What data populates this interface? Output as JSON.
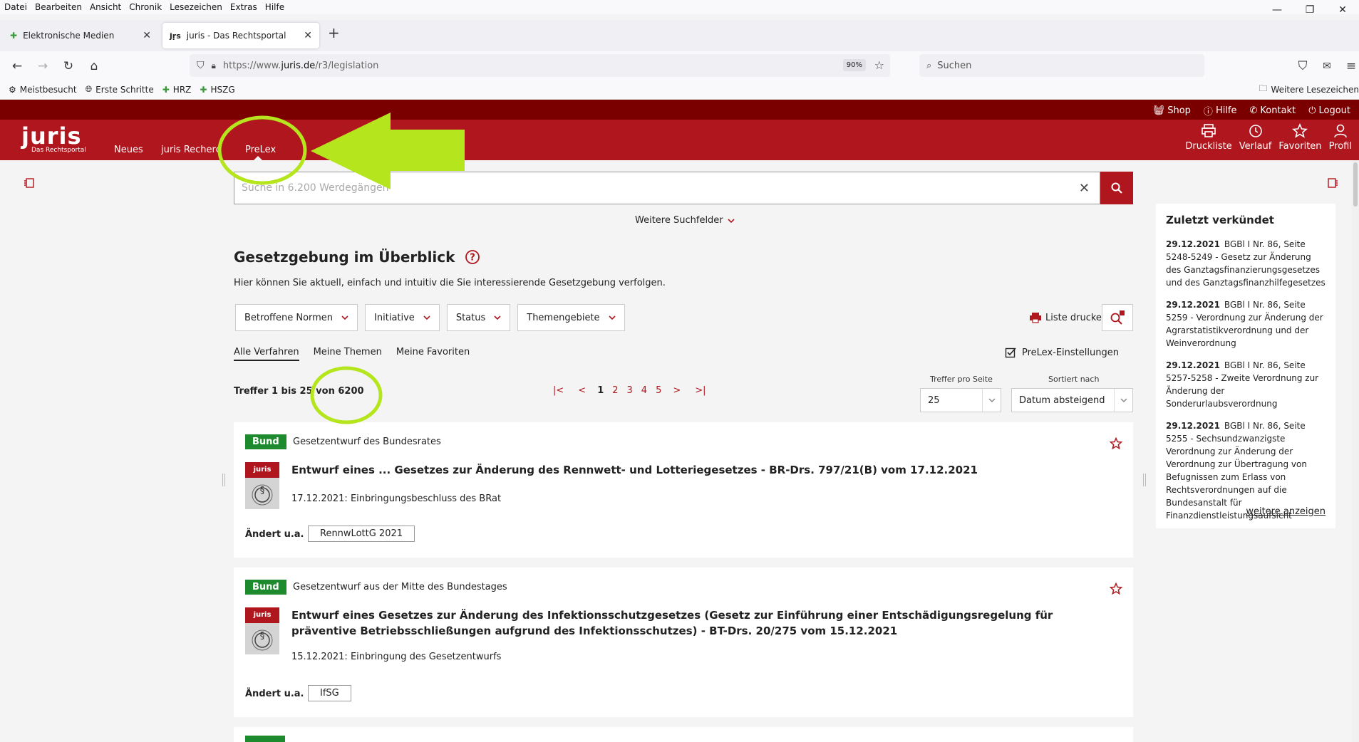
{
  "menubar": [
    "Datei",
    "Bearbeiten",
    "Ansicht",
    "Chronik",
    "Lesezeichen",
    "Extras",
    "Hilfe"
  ],
  "tabs": [
    {
      "title": "Elektronische Medien"
    },
    {
      "title": "juris - Das Rechtsportal"
    }
  ],
  "url": {
    "prefix": "https://www.",
    "domain": "juris.de",
    "path": "/r3/legislation",
    "zoom": "90%"
  },
  "browser_search": {
    "placeholder": "Suchen"
  },
  "bookmarks": [
    "Meistbesucht",
    "Erste Schritte",
    "HRZ",
    "HSZG"
  ],
  "bookmarks_more": "Weitere Lesezeichen",
  "top_links": [
    "Shop",
    "Hilfe",
    "Kontakt",
    "Logout"
  ],
  "logo": {
    "name": "juris",
    "sub": "Das Rechtsportal"
  },
  "main_nav": [
    "Neues",
    "juris Recherche",
    "PreLex"
  ],
  "right_nav": [
    "Druckliste",
    "Verlauf",
    "Favoriten",
    "Profil"
  ],
  "search": {
    "placeholder": "Suche in 6.200 Werdegängen"
  },
  "weitere_suchfelder": "Weitere Suchfelder",
  "heading": "Gesetzgebung im Überblick",
  "intro": "Hier können Sie aktuell, einfach und intuitiv die Sie interessierende Gesetzgebung verfolgen.",
  "filters": [
    "Betroffene Normen",
    "Initiative",
    "Status",
    "Themengebiete"
  ],
  "print_list": "Liste drucken",
  "subtabs": [
    "Alle Verfahren",
    "Meine Themen",
    "Meine Favoriten"
  ],
  "settings": "PreLex-Einstellungen",
  "treffer": "Treffer 1 bis 25 von 6200",
  "pagination": [
    "1",
    "2",
    "3",
    "4",
    "5"
  ],
  "per_page": {
    "label": "Treffer pro Seite",
    "value": "25"
  },
  "sort": {
    "label": "Sortiert nach",
    "value": "Datum absteigend"
  },
  "cards": [
    {
      "badge": "Bund",
      "type": "Gesetzentwurf des Bundesrates",
      "title": "Entwurf eines ... Gesetzes zur Änderung des Rennwett- und Lotteriegesetzes - BR-Drs. 797/21(B) vom 17.12.2021",
      "date": "17.12.2021: Einbringungsbeschluss des BRat",
      "aendert_label": "Ändert u.a.",
      "norm": "RennwLottG 2021"
    },
    {
      "badge": "Bund",
      "type": "Gesetzentwurf aus der Mitte des Bundestages",
      "title": "Entwurf eines Gesetzes zur Änderung des Infektionsschutzgesetzes (Gesetz zur Einführung einer Entschädigungsregelung für präventive Betriebsschließun­gen aufgrund des Infektionsschutzes) - BT-Drs. 20/275 vom 15.12.2021",
      "date": "15.12.2021: Einbringung des Gesetzentwurfs",
      "aendert_label": "Ändert u.a.",
      "norm": "IfSG"
    }
  ],
  "sidebar": {
    "title": "Zuletzt verkündet",
    "items": [
      {
        "date": "29.12.2021",
        "text": "BGBl I Nr. 86, Seite 5248-5249 - Gesetz zur Änderung des Ganztagsfinanzierungsgesetzes und des Ganztagsfinanzhilfegesetzes"
      },
      {
        "date": "29.12.2021",
        "text": "BGBl I Nr. 86, Seite 5259 - Verordnung zur Änderung der Agrarsta­tistikverordnung und der Weinverord­nung"
      },
      {
        "date": "29.12.2021",
        "text": "BGBl I Nr. 86, Seite 5257-5258 - Zweite Verordnung zur Än­derung der Sonderurlaubsverordnung"
      },
      {
        "date": "29.12.2021",
        "text": "BGBl I Nr. 86, Seite 5255 - Sechsundzwanzigste Verordnung zur Änderung der Verordnung zur Übertra­gung von Befugnissen zum Erlass von Rechtsverordnungen auf die Bundesan­stalt für Finanzdienstleistungsaufsicht"
      }
    ],
    "more": "weitere anzeigen"
  },
  "colors": {
    "brand_red": "#b0161d",
    "dark_red": "#7a0000",
    "badge_green": "#1e8a2e",
    "annotation": "#b5e61d"
  }
}
